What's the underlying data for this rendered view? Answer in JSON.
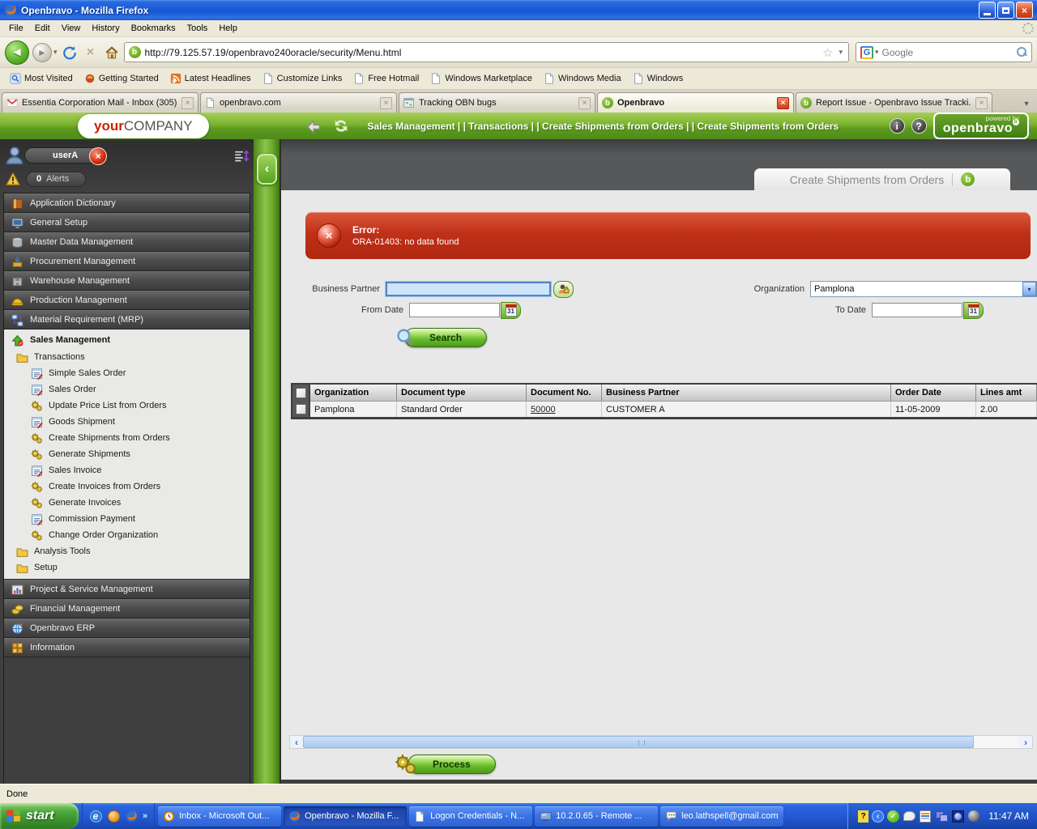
{
  "glyphs": {
    "close_x": "×",
    "star": "☆",
    "caret_down": "▾",
    "chevron_left": "‹",
    "chevron_right": "›",
    "chevron_more": "»",
    "back_arrow": "◄",
    "fwd_arrow": "►",
    "ob_mark": "b",
    "ie_mark": "e",
    "info_mark": "i",
    "help_mark": "?",
    "tray_help_mark": "?"
  },
  "browser": {
    "title": "Openbravo - Mozilla Firefox",
    "menu": [
      "File",
      "Edit",
      "View",
      "History",
      "Bookmarks",
      "Tools",
      "Help"
    ],
    "url": "http://79.125.57.19/openbravo240oracle/security/Menu.html",
    "search_logo": "G",
    "search_placeholder": "Google",
    "bookmarks": [
      "Most Visited",
      "Getting Started",
      "Latest Headlines",
      "Customize Links",
      "Free Hotmail",
      "Windows Marketplace",
      "Windows Media",
      "Windows"
    ],
    "tabs": [
      {
        "label": "Essentia Corporation Mail - Inbox (305)..."
      },
      {
        "label": "openbravo.com"
      },
      {
        "label": "Tracking OBN bugs"
      },
      {
        "label": "Openbravo"
      },
      {
        "label": "Report Issue - Openbravo Issue Tracki..."
      }
    ]
  },
  "app_header": {
    "logo_your": "your",
    "logo_company": "COMPANY",
    "breadcrumb": "Sales Management  | |  Transactions  | |  Create Shipments from Orders  | |  Create Shipments from Orders",
    "powered_by": "powered by",
    "brand": "openbravo"
  },
  "sidebar": {
    "user": "userA",
    "alerts_count": "0",
    "alerts_label": "Alerts",
    "top_sections": [
      "Application Dictionary",
      "General Setup",
      "Master Data Management",
      "Procurement Management",
      "Warehouse Management",
      "Production Management",
      "Material Requirement (MRP)"
    ],
    "expanded_header": "Sales Management",
    "expanded_items": [
      "Transactions",
      "Simple Sales Order",
      "Sales Order",
      "Update Price List from Orders",
      "Goods Shipment",
      "Create Shipments from Orders",
      "Generate Shipments",
      "Sales Invoice",
      "Create Invoices from Orders",
      "Generate Invoices",
      "Commission Payment",
      "Change Order Organization",
      "Analysis Tools",
      "Setup"
    ],
    "bottom_sections": [
      "Project & Service Management",
      "Financial Management",
      "Openbravo ERP",
      "Information"
    ]
  },
  "main": {
    "tab_title": "Create Shipments from Orders",
    "error": {
      "title": "Error:",
      "message": "ORA-01403: no data found"
    },
    "form": {
      "business_partner_label": "Business Partner",
      "organization_label": "Organization",
      "organization_value": "Pamplona",
      "from_date_label": "From Date",
      "to_date_label": "To Date",
      "calendar_day": "31",
      "search_label": "Search"
    },
    "table": {
      "columns": [
        "Organization",
        "Document type",
        "Document No.",
        "Business Partner",
        "Order Date",
        "Lines amt"
      ],
      "rows": [
        [
          "Pamplona",
          "Standard Order",
          "50000",
          "CUSTOMER A",
          "11-05-2009",
          "2.00"
        ]
      ]
    },
    "process_label": "Process"
  },
  "statusbar": {
    "text": "Done"
  },
  "taskbar": {
    "start_label": "start",
    "buttons": [
      "Inbox - Microsoft Out...",
      "Openbravo - Mozilla F...",
      "Logon Credentials - N...",
      "10.2.0.65 - Remote ...",
      "leo.lathspell@gmail.com"
    ],
    "clock": "11:47 AM"
  },
  "colors": {
    "openbravo_green": "#5d9a1e",
    "error_red": "#c03018",
    "xp_blue": "#2258d2"
  }
}
